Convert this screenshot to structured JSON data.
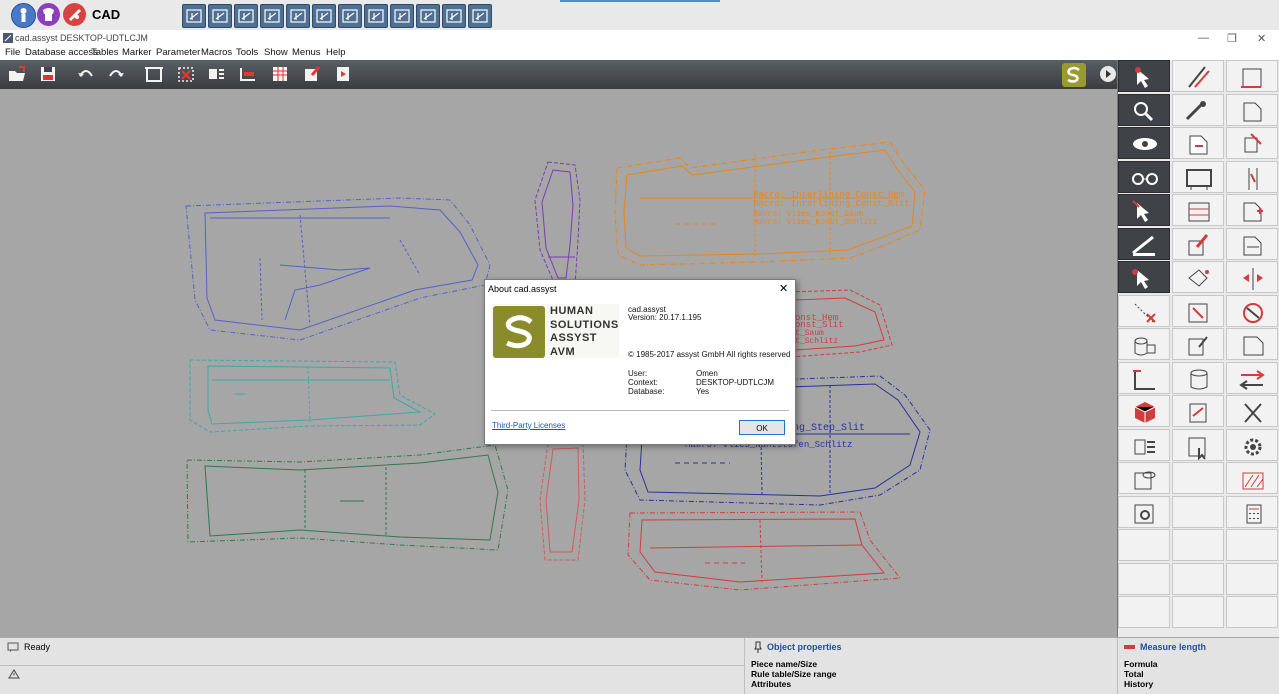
{
  "launcher": {
    "app_label": "CAD"
  },
  "window": {
    "title": "cad.assyst  DESKTOP-UDTLCJM"
  },
  "menu": [
    "File",
    "Database access",
    "Tables",
    "Marker",
    "Parameter",
    "Macros",
    "Tools",
    "Show",
    "Menus",
    "Help"
  ],
  "canvas": {
    "macro_orange_1": "Macro: Interlining_Const_Hem",
    "macro_orange_2": "Macro: Interlining_Const_Slit",
    "makro_orange_1": "Makro: Vlies_Konst_Saum",
    "makro_orange_2": "Makro: Vlies_Konst_Schlitz",
    "red_frag_1": "onst_Hem",
    "red_frag_2": "onst_Slit",
    "red_frag_3": "t_Saum",
    "red_frag_4": "t_Schlitz",
    "blue_macro_1": "ng_Step_Slit",
    "blue_macro_2": "Makro: Vlies_Nahtstufen_Schlitz"
  },
  "dialog": {
    "title": "About cad.assyst",
    "logo_lines": [
      "HUMAN",
      "SOLUTIONS",
      "ASSYST",
      "AVM"
    ],
    "product": "cad.assyst",
    "version": "Version: 20.17.1.195",
    "copyright": "© 1985-2017 assyst GmbH All rights reserved",
    "user_label": "User:",
    "user_value": "Omen",
    "context_label": "Context:",
    "context_value": "DESKTOP-UDTLCJM",
    "database_label": "Database:",
    "database_value": "Yes",
    "licenses_link": "Third-Party Licenses",
    "ok": "OK"
  },
  "status": {
    "ready": "Ready",
    "object_properties": "Object properties",
    "piece_name": "Piece name/Size",
    "rule_table": "Rule table/Size range",
    "attributes": "Attributes",
    "measure_length": "Measure length",
    "formula": "Formula",
    "total": "Total",
    "history": "History"
  },
  "colors": {
    "orange": "#e8861c",
    "blue": "#5660c8",
    "teal": "#3aa8a8",
    "green": "#2f7a4d",
    "purple": "#7d3ab5",
    "red": "#d23c3c",
    "navy": "#2b2fa0",
    "logo": "#8a8b2a"
  }
}
